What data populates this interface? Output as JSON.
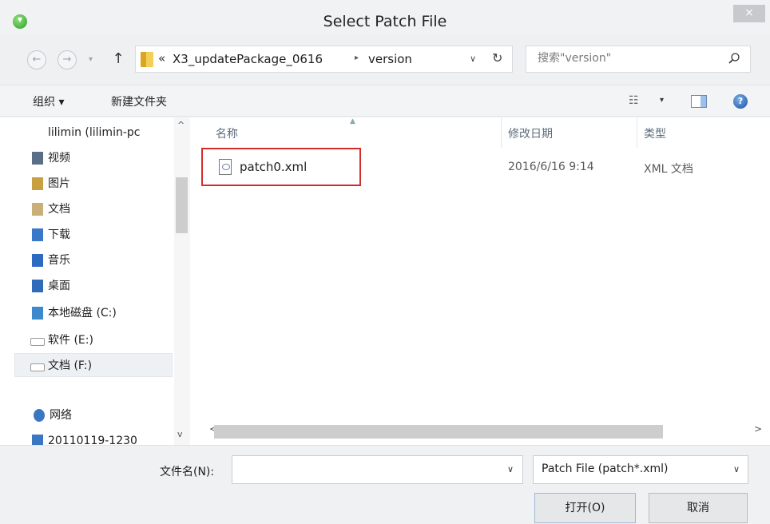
{
  "window": {
    "title": "Select Patch File",
    "close_label": "×"
  },
  "navigation": {
    "back": "←",
    "forward": "→",
    "recent": "▾",
    "up": "↑",
    "breadcrumb_prefix": "«",
    "breadcrumbs": [
      "X3_updatePackage_0616",
      "version"
    ],
    "breadcrumb_separator": "▸",
    "dropdown": "∨",
    "refresh": "↻"
  },
  "search": {
    "placeholder": "搜索\"version\""
  },
  "commandbar": {
    "organize_label": "组织 ▾",
    "new_folder_label": "新建文件夹",
    "view_label": "☷",
    "view_dropdown": "▾",
    "help_label": "?"
  },
  "nav_pane": {
    "items": [
      {
        "label": "lilimin (lilimin-pc",
        "icon": "network-computer-icon",
        "color": "#8a8a8a"
      },
      {
        "label": "视频",
        "icon": "video-library-icon",
        "color": "#5b6e88"
      },
      {
        "label": "图片",
        "icon": "pictures-library-icon",
        "color": "#c8a040"
      },
      {
        "label": "文档",
        "icon": "documents-library-icon",
        "color": "#c9b07a"
      },
      {
        "label": "下载",
        "icon": "downloads-folder-icon",
        "color": "#3a78c8"
      },
      {
        "label": "音乐",
        "icon": "music-library-icon",
        "color": "#2d6bc2"
      },
      {
        "label": "桌面",
        "icon": "desktop-folder-icon",
        "color": "#2f6bb8"
      },
      {
        "label": "本地磁盘 (C:)",
        "icon": "local-disk-icon",
        "color": "#3c8acb"
      },
      {
        "label": "软件 (E:)",
        "icon": "drive-icon",
        "color": "#9a9a9a"
      },
      {
        "label": "文档 (F:)",
        "icon": "drive-icon",
        "color": "#9a9a9a",
        "selected": true
      },
      {
        "label": "网络",
        "icon": "network-icon",
        "color": "#3b76c3"
      },
      {
        "label": "20110119-1230",
        "icon": "computer-icon",
        "color": "#3b76c3"
      }
    ],
    "scroll_up": "^",
    "scroll_down": "v"
  },
  "file_list": {
    "columns": [
      "名称",
      "修改日期",
      "类型"
    ],
    "sort_arrow": "▲",
    "rows": [
      {
        "name": "patch0.xml",
        "modified": "2016/6/16 9:14",
        "type": "XML 文档"
      }
    ],
    "scroll_left": "<",
    "scroll_right": ">"
  },
  "bottom": {
    "filename_label": "文件名(N):",
    "filename_value": "",
    "filename_dropdown": "∨",
    "filetype_value": "Patch File (patch*.xml)",
    "filetype_dropdown": "∨",
    "open_label": "打开(O)",
    "cancel_label": "取消"
  }
}
